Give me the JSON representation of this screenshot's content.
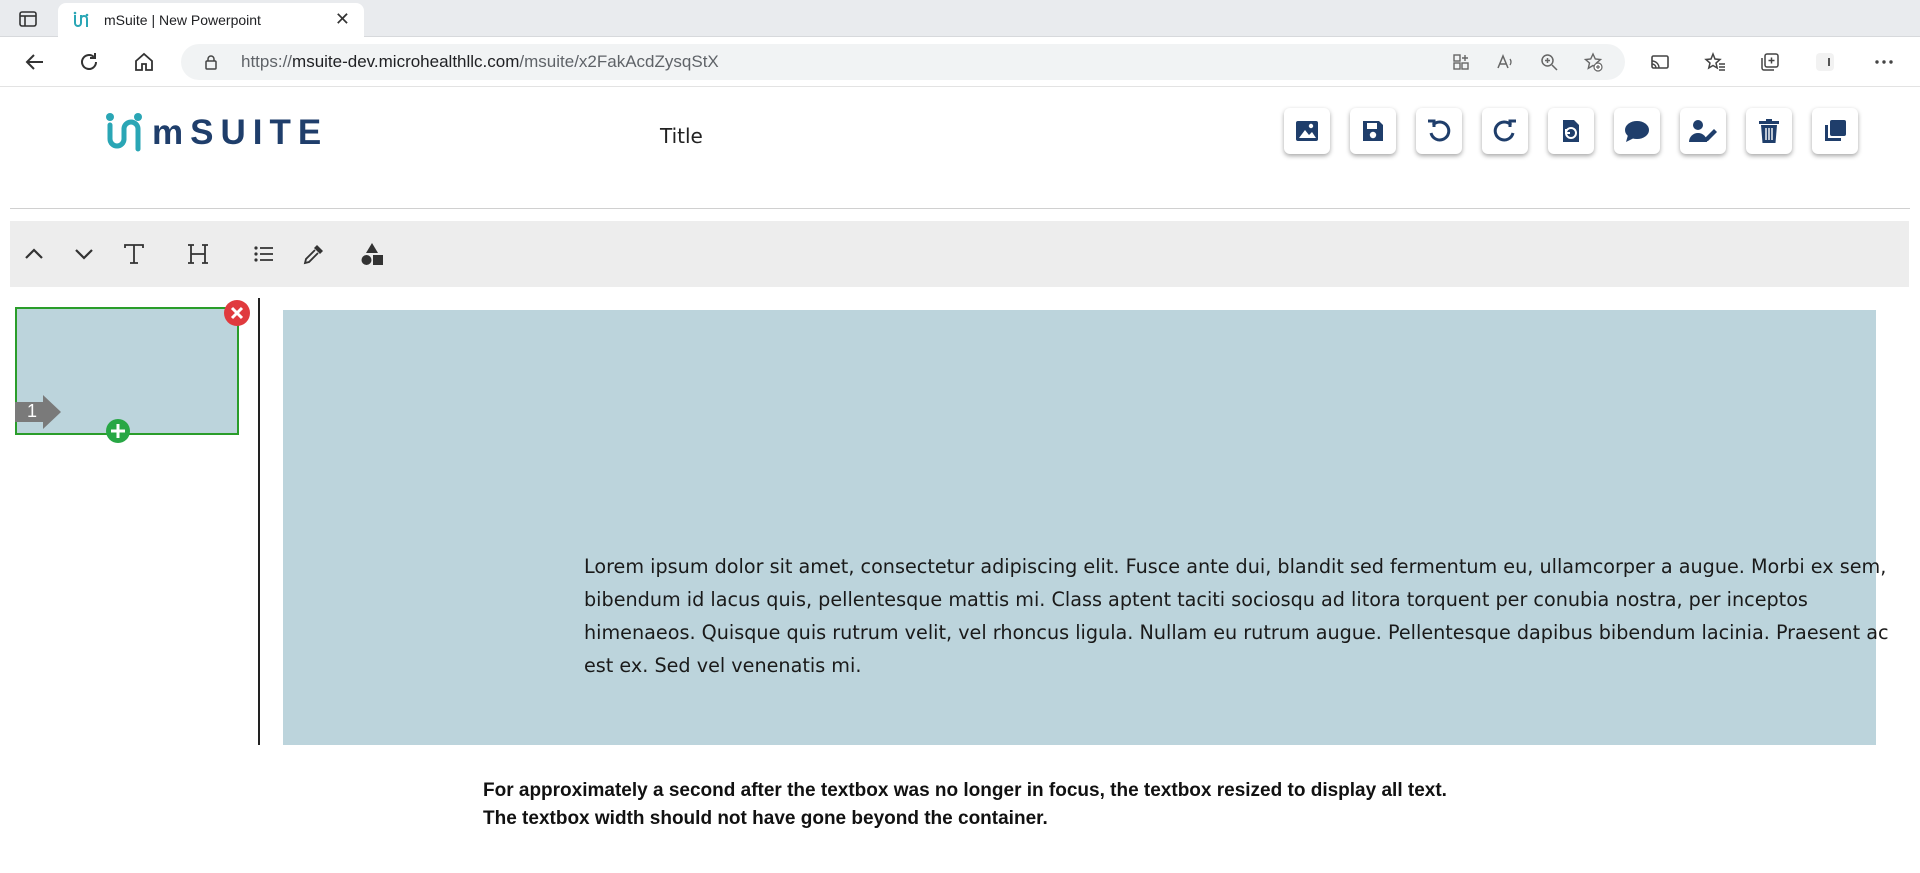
{
  "browser": {
    "tab_title": "mSuite | New Powerpoint",
    "url_prefix": "https://",
    "url_domain": "msuite-dev.microhealthllc.com",
    "url_path": "/msuite/x2FakAcdZysqStX"
  },
  "app": {
    "logo_text": "mSUITE",
    "document_title": "Title",
    "brand_color": "#1f3e6b",
    "accent_color": "#2aa6b5",
    "toolbar_icons": [
      "image-icon",
      "save-icon",
      "undo-icon",
      "redo-icon",
      "restore-icon",
      "comment-icon",
      "user-edit-icon",
      "trash-icon",
      "copy-icon"
    ],
    "editor_tools": [
      "chevron-up-icon",
      "chevron-down-icon",
      "text-icon",
      "heading-icon",
      "list-icon",
      "eyedropper-icon",
      "shapes-icon"
    ]
  },
  "slides": {
    "items": [
      {
        "number": "1"
      }
    ]
  },
  "slide": {
    "background_color": "#bcd4dc",
    "body_text": "Lorem ipsum dolor sit amet, consectetur adipiscing elit. Fusce ante dui, blandit sed fermentum eu, ullamcorper a augue. Morbi ex sem, bibendum id lacus quis, pellentesque mattis mi. Class aptent taciti sociosqu ad litora torquent per conubia nostra, per inceptos himenaeos. Quisque quis rutrum velit, vel rhoncus ligula. Nullam eu rutrum augue. Pellentesque dapibus bibendum lacinia. Praesent ac est ex. Sed vel venenatis mi."
  },
  "annotation": {
    "line1": "For approximately a second after the textbox was no longer in focus, the textbox resized to display all text.",
    "line2": "The textbox width should not have gone beyond the container."
  }
}
